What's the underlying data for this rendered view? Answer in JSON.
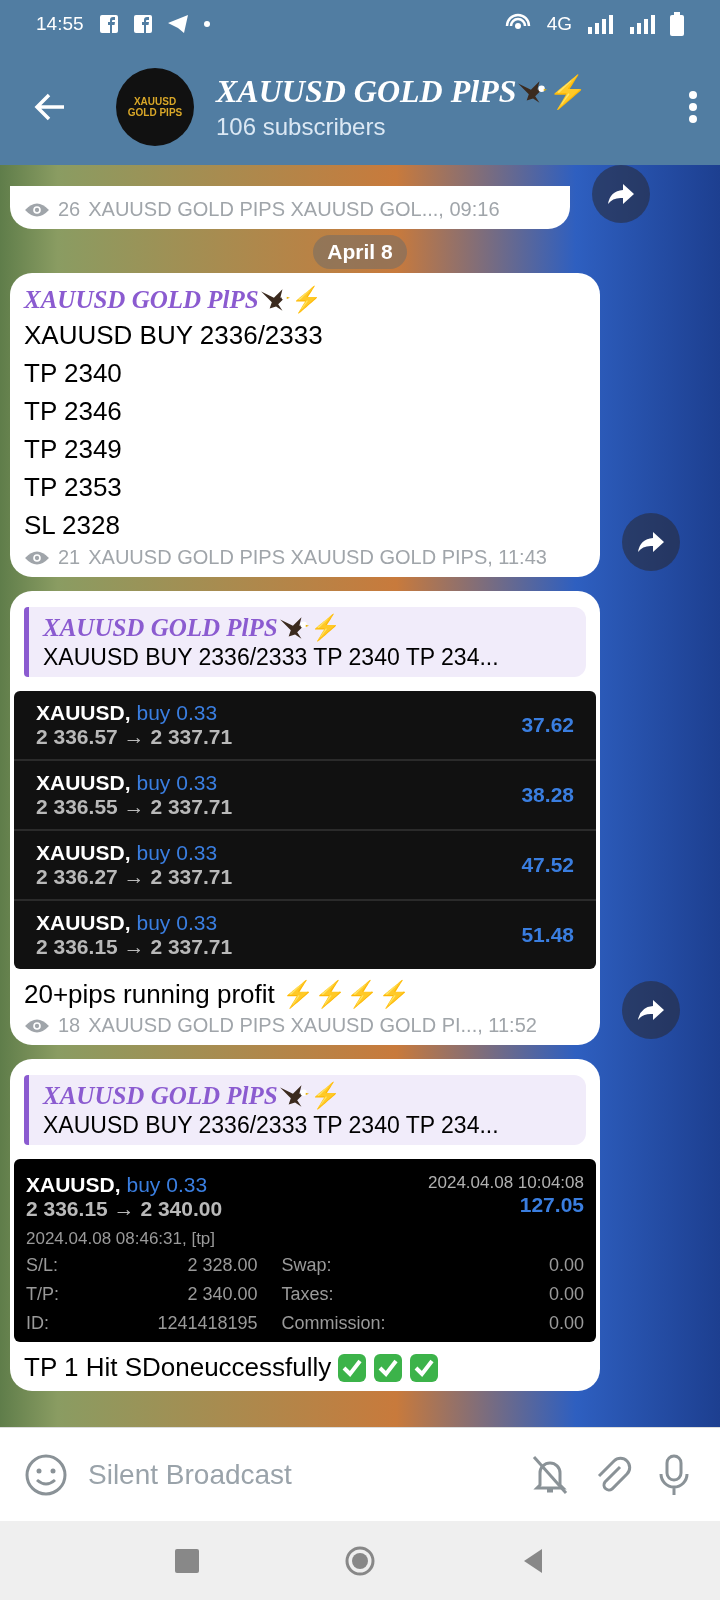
{
  "status_bar": {
    "time": "14:55",
    "network": "4G"
  },
  "header": {
    "title": "XAUUSD GOLD PlPS",
    "title_suffix": "⚡",
    "subtitle": "106 subscribers",
    "avatar_text": [
      "XAUUSD",
      "GOLD PIPS"
    ]
  },
  "date_chip": "April 8",
  "messages": [
    {
      "kind": "partial",
      "views": "26",
      "meta": "XAUUSD GOLD PIPS XAUUSD GOL..., 09:16",
      "forward": true
    },
    {
      "kind": "post",
      "title": "XAUUSD GOLD PlPS",
      "title_suffix": "⚡",
      "lines": [
        "XAUUSD BUY 2336/2333",
        "TP 2340",
        "TP 2346",
        "TP 2349",
        "TP 2353",
        "SL 2328"
      ],
      "views": "21",
      "meta": "XAUUSD GOLD PIPS XAUUSD GOLD PIPS, 11:43",
      "forward": true
    },
    {
      "kind": "trades",
      "reply": {
        "title": "XAUUSD GOLD PlPS",
        "title_suffix": "⚡",
        "text": "XAUUSD BUY 2336/2333 TP 2340 TP 234..."
      },
      "trades": [
        {
          "symbol": "XAUUSD,",
          "side": "buy 0.33",
          "prices": "2 336.57 → 2 337.71",
          "profit": "37.62"
        },
        {
          "symbol": "XAUUSD,",
          "side": "buy 0.33",
          "prices": "2 336.55 → 2 337.71",
          "profit": "38.28"
        },
        {
          "symbol": "XAUUSD,",
          "side": "buy 0.33",
          "prices": "2 336.27 → 2 337.71",
          "profit": "47.52"
        },
        {
          "symbol": "XAUUSD,",
          "side": "buy 0.33",
          "prices": "2 336.15 → 2 337.71",
          "profit": "51.48"
        }
      ],
      "text": "20+pips running profit ⚡⚡⚡⚡",
      "views": "18",
      "meta": "XAUUSD GOLD PIPS XAUUSD GOLD PI..., 11:52",
      "forward": true
    },
    {
      "kind": "detail",
      "reply": {
        "title": "XAUUSD GOLD PlPS",
        "title_suffix": "⚡",
        "text": "XAUUSD BUY 2336/2333 TP 2340 TP 234..."
      },
      "detail": {
        "symbol": "XAUUSD,",
        "side": "buy 0.33",
        "prices": "2 336.15 → 2 340.00",
        "close_time": "2024.04.08 10:04:08",
        "profit": "127.05",
        "open_info": "2024.04.08 08:46:31, [tp]",
        "fields": [
          {
            "label": "S/L:",
            "value": "2 328.00"
          },
          {
            "label": "Swap:",
            "value": "0.00"
          },
          {
            "label": "T/P:",
            "value": "2 340.00"
          },
          {
            "label": "Taxes:",
            "value": "0.00"
          },
          {
            "label": "ID:",
            "value": "1241418195"
          },
          {
            "label": "Commission:",
            "value": "0.00"
          }
        ]
      },
      "text": "TP 1 Hit SDoneuccessfully",
      "checks": [
        {
          "kind": "check"
        },
        {
          "kind": "check"
        },
        {
          "kind": "check"
        }
      ],
      "forward": false
    }
  ],
  "input": {
    "placeholder": "Silent Broadcast"
  }
}
